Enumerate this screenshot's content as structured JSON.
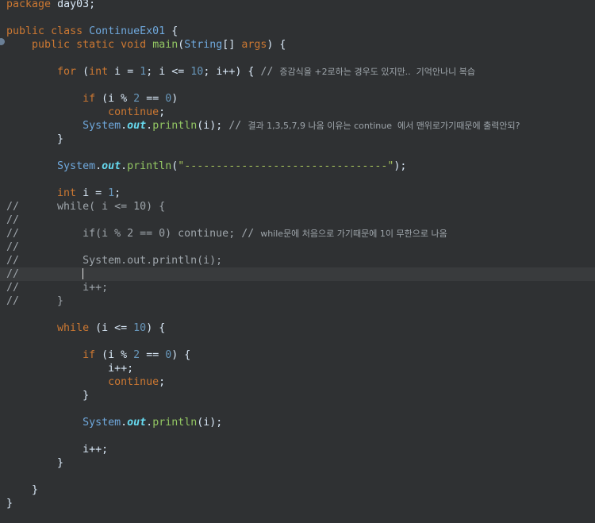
{
  "lines": [
    "package day03;",
    "",
    "public class ContinueEx01 {",
    "    public static void main(String[] args) {",
    "",
    "        for (int i = 1; i <= 10; i++) { // 증감식을 +2로하는 경우도 있지만..  기억안나니 복습",
    "",
    "            if (i % 2 == 0)",
    "                continue;",
    "            System.out.println(i); // 결과 1,3,5,7,9 나옴 이유는 continue  에서 맨위로가기때문에 출력안되?",
    "        }",
    "",
    "        System.out.println(\"--------------------------------\");",
    "",
    "        int i = 1;",
    "//      while( i <= 10) {",
    "//",
    "//          if(i % 2 == 0) continue; // while문에 처음으로 가기때문에 1이 무한으로 나옴",
    "//",
    "//          System.out.println(i);",
    "//",
    "//          i++;",
    "//      }",
    "",
    "        while (i <= 10) {",
    "",
    "            if (i % 2 == 0) {",
    "                i++;",
    "                continue;",
    "            }",
    "",
    "            System.out.println(i);",
    "",
    "            i++;",
    "        }",
    "",
    "    }",
    "}"
  ],
  "tokens": {
    "package": "package",
    "pkg_name": "day03",
    "public": "public",
    "class": "class",
    "class_name": "ContinueEx01",
    "static": "static",
    "void": "void",
    "main": "main",
    "string": "String",
    "args": "args",
    "for": "for",
    "int": "int",
    "if": "if",
    "continue": "continue",
    "system": "System",
    "out": "out",
    "println": "println",
    "while": "while",
    "i": "i",
    "n0": "0",
    "n1": "1",
    "n2": "2",
    "n10": "10",
    "dashes": "\"--------------------------------\"",
    "cmt_for": "// ",
    "cmt_for_ko": "증감식을 +2로하는 경우도 있지만..  기억안나니 복습",
    "cmt_print": "// ",
    "cmt_print_ko": "결과 1,3,5,7,9 나옴 이유는 continue  에서 맨위로가기때문에 출력안되?",
    "cl_while": "//      while( i <= 10) {",
    "cl_empty": "//",
    "cl_if_a": "//          if(i % 2 == 0) continue; // ",
    "cl_if_ko": "while문에 처음으로 가기때문에 1이 무한으로 나옴",
    "cl_print": "//          System.out.println(i);",
    "cl_caret_prefix": "//          ",
    "cl_inc": "//          i++;",
    "cl_close": "//      }"
  }
}
